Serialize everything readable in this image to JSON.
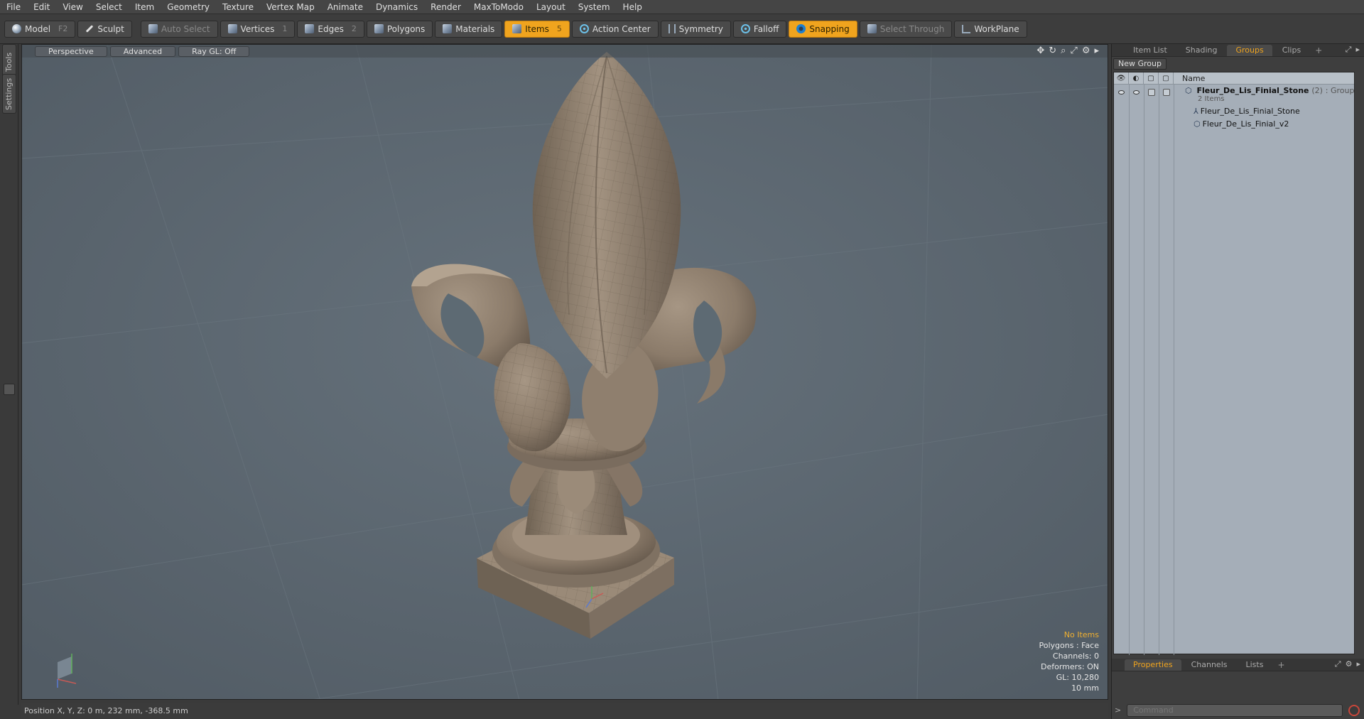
{
  "menu": [
    "File",
    "Edit",
    "View",
    "Select",
    "Item",
    "Geometry",
    "Texture",
    "Vertex Map",
    "Animate",
    "Dynamics",
    "Render",
    "MaxToModo",
    "Layout",
    "System",
    "Help"
  ],
  "toolbar": {
    "model": {
      "label": "Model",
      "key": "F2"
    },
    "sculpt": {
      "label": "Sculpt"
    },
    "auto_select": {
      "label": "Auto Select"
    },
    "vertices": {
      "label": "Vertices",
      "key": "1"
    },
    "edges": {
      "label": "Edges",
      "key": "2"
    },
    "polygons": {
      "label": "Polygons"
    },
    "materials": {
      "label": "Materials"
    },
    "items": {
      "label": "Items",
      "key": "5"
    },
    "action_center": {
      "label": "Action Center"
    },
    "symmetry": {
      "label": "Symmetry"
    },
    "falloff": {
      "label": "Falloff"
    },
    "snapping": {
      "label": "Snapping"
    },
    "select_through": {
      "label": "Select Through"
    },
    "workplane": {
      "label": "WorkPlane"
    }
  },
  "left_strip": {
    "tools": "Tools",
    "settings": "Settings"
  },
  "viewport": {
    "tabs": {
      "perspective": "Perspective",
      "advanced": "Advanced",
      "raygl": "Ray GL: Off"
    },
    "stats": {
      "selection": "No Items",
      "polygons": "Polygons : Face",
      "channels": "Channels: 0",
      "deformers": "Deformers: ON",
      "gl": "GL: 10,280",
      "units": "10 mm"
    },
    "model_color": "#8b7b6a",
    "background_color": "#5b6670"
  },
  "statusbar": {
    "position": "Position X, Y, Z:  0 m, 232 mm, -368.5 mm"
  },
  "right_panel": {
    "top_tabs": {
      "item_list": "Item List",
      "shading": "Shading",
      "groups": "Groups",
      "clips": "Clips",
      "plus": "+"
    },
    "new_group": "New Group",
    "tree_header": {
      "name": "Name"
    },
    "group": {
      "name": "Fleur_De_Lis_Finial_Stone",
      "count": "(2)",
      "type": ": Group",
      "subtitle": "2 Items"
    },
    "children": [
      {
        "name": "Fleur_De_Lis_Finial_Stone"
      },
      {
        "name": "Fleur_De_Lis_Finial_v2"
      }
    ],
    "bottom_tabs": {
      "properties": "Properties",
      "channels": "Channels",
      "lists": "Lists",
      "plus": "+"
    },
    "command_placeholder": "Command",
    "accent_color": "#f0a41e"
  }
}
